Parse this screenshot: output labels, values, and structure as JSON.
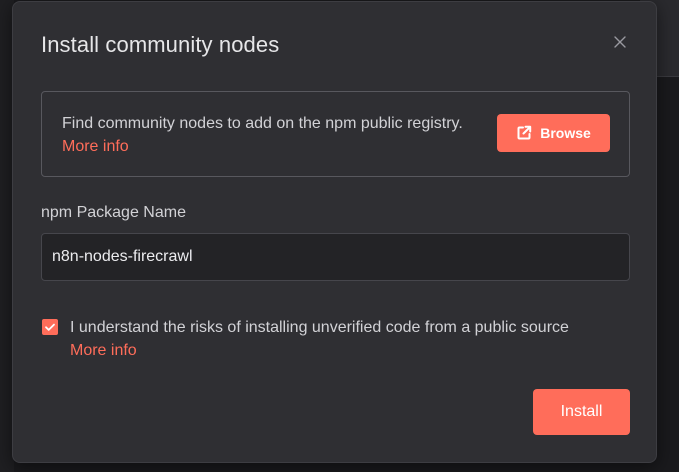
{
  "dialog": {
    "title": "Install community nodes",
    "close_icon": "close-icon"
  },
  "info": {
    "text": "Find community nodes to add on the npm public registry.",
    "more_info_label": "More info",
    "browse_label": "Browse",
    "browse_icon": "external-link-icon"
  },
  "package_field": {
    "label": "npm Package Name",
    "value": "n8n-nodes-firecrawl",
    "placeholder": ""
  },
  "risk_checkbox": {
    "checked": true,
    "label": "I understand the risks of installing unverified code from a public source",
    "more_info_label": "More info"
  },
  "footer": {
    "install_label": "Install"
  },
  "colors": {
    "accent": "#ff6d5a",
    "dialog_bg": "#2f2f33",
    "text": "#d2d2d6",
    "title": "#e6e6e8"
  }
}
